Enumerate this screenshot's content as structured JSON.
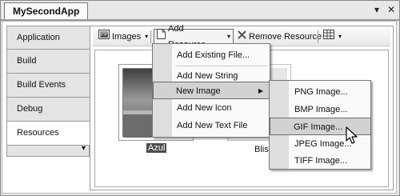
{
  "window": {
    "doc_tab": "MySecondApp",
    "pin_glyph": "▾",
    "close_glyph": "✕"
  },
  "sidebar": {
    "items": [
      {
        "label": "Application"
      },
      {
        "label": "Build"
      },
      {
        "label": "Build Events"
      },
      {
        "label": "Debug"
      },
      {
        "label": "Resources"
      }
    ],
    "more_glyph": "▾"
  },
  "toolbar": {
    "images_label": "Images",
    "add_resource_label": "Add Resource",
    "remove_resource_label": "Remove Resource",
    "caret": "▾"
  },
  "resources": [
    {
      "caption": "Azul"
    },
    {
      "caption": "Bliss"
    }
  ],
  "add_menu": {
    "items": [
      {
        "label": "Add Existing File..."
      },
      {
        "label": "Add New String"
      },
      {
        "label": "New Image",
        "arrow": "▶"
      },
      {
        "label": "Add New Icon"
      },
      {
        "label": "Add New Text File"
      }
    ]
  },
  "image_menu": {
    "items": [
      {
        "label": "PNG Image..."
      },
      {
        "label": "BMP Image..."
      },
      {
        "label": "GIF Image..."
      },
      {
        "label": "JPEG Image..."
      },
      {
        "label": "TIFF Image..."
      }
    ]
  }
}
